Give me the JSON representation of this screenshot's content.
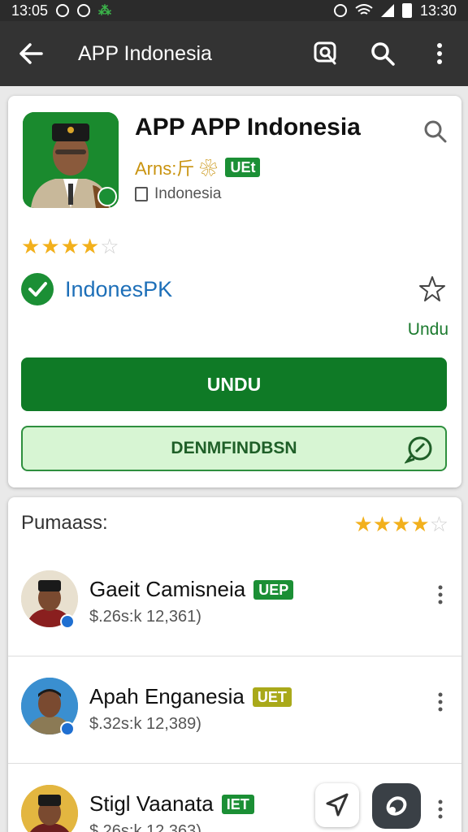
{
  "status_bar": {
    "time_left": "13:05",
    "time_right": "13:30"
  },
  "app_bar": {
    "title": "APP Indonesia"
  },
  "app": {
    "title": "APP APP Indonesia",
    "publisher": "Arns:⽄ ❀",
    "publisher_tag": "UEt",
    "region": "Indonesia",
    "rating_stars": 4,
    "developer": "IndonesPK",
    "undu_link": "Undu",
    "primary_button": "UNDU",
    "secondary_button": "DENMFINDBSN"
  },
  "reviews": {
    "heading": "Pumaass:",
    "stars": 4,
    "items": [
      {
        "name": "Gaeit Camisneia",
        "tag": "UEP",
        "tag_color": "#1b8f35",
        "sub": "$.26s:k 12,361)"
      },
      {
        "name": "Apah Enganesia",
        "tag": "UET",
        "tag_color": "#a9a91a",
        "sub": "$.32s:k 12,389)"
      },
      {
        "name": "Stigl Vaanata",
        "tag": "IET",
        "tag_color": "#1b8f35",
        "sub": "$.26s:k 12,363)"
      }
    ]
  },
  "colors": {
    "primary_green": "#0f7a26",
    "star": "#f2b01c",
    "app_bar": "#333333"
  }
}
